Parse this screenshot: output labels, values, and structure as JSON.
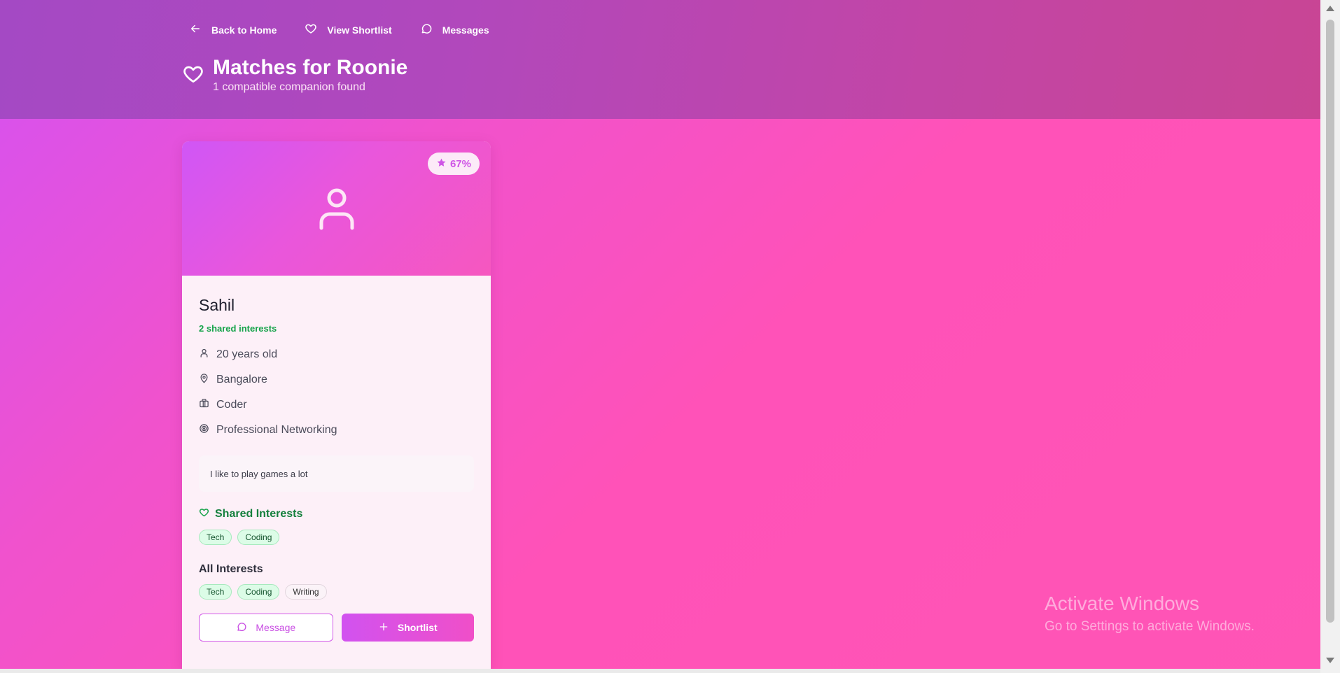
{
  "nav": {
    "back_label": "Back to Home",
    "shortlist_label": "View Shortlist",
    "messages_label": "Messages"
  },
  "header": {
    "title": "Matches for Roonie",
    "subtitle": "1 compatible companion found"
  },
  "match": {
    "score": "67%",
    "name": "Sahil",
    "shared_count": "2 shared interests",
    "age": "20 years old",
    "location": "Bangalore",
    "occupation": "Coder",
    "purpose": "Professional Networking",
    "bio": "I like to play games a lot",
    "shared_interests_title": "Shared Interests",
    "shared_interests": [
      "Tech",
      "Coding"
    ],
    "all_interests_title": "All Interests",
    "all_interests": [
      "Tech",
      "Coding",
      "Writing"
    ],
    "message_label": "Message",
    "shortlist_label": "Shortlist"
  },
  "watermark": {
    "title": "Activate Windows",
    "subtitle": "Go to Settings to activate Windows."
  },
  "colors": {
    "accent": "#d152f0",
    "pink": "#ff52b8",
    "success": "#16a34a"
  }
}
